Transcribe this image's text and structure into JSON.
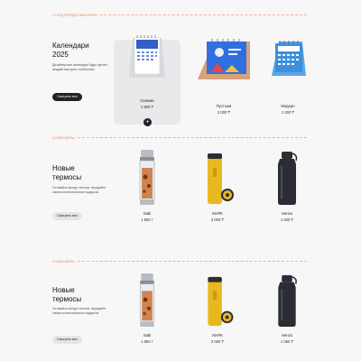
{
  "sections": [
    {
      "label": "СПЕЦПРЕДЛОЖЕНИЯ",
      "title_line1": "Календари",
      "title_line2": "2025",
      "description": "Дизайнерские календари будут делать каждый ваш день особенным",
      "button": "Смотреть все",
      "products": [
        {
          "name": "Синема",
          "price": "1 800 ₸"
        },
        {
          "name": "Пустыня",
          "price": "3 000 ₸"
        },
        {
          "name": "Модерн",
          "price": "1 000 ₸"
        }
      ],
      "add_symbol": "+"
    },
    {
      "label": "СУВЕНИРЫ",
      "title_line1": "Новые",
      "title_line2": "термосы",
      "description": "Оставайся всегда теплым, передайте своим коллегиальным подарком",
      "button": "Смотреть все",
      "products": [
        {
          "name": "Sabi",
          "price": "1 800 т"
        },
        {
          "name": "МАРК",
          "price": "3 000 ₸"
        },
        {
          "name": "Henzo",
          "price": "1 000 ₸"
        }
      ]
    },
    {
      "label": "СУВЕНИРЫ",
      "title_line1": "Новые",
      "title_line2": "термосы",
      "description": "Оставайся всегда теплым, передайте своим коллегиальным подарком",
      "button": "Смотреть все",
      "products": [
        {
          "name": "Sabi",
          "price": "1 800 т"
        },
        {
          "name": "МАРК",
          "price": "3 000 ₸"
        },
        {
          "name": "Henzo",
          "price": "1 050 ₸"
        }
      ]
    }
  ],
  "colors": {
    "accent": "#f07a4a",
    "dark_button": "#1f2328",
    "calendar_blue": "#2f6fe0",
    "thermos_yellow": "#e8b81f",
    "thermos_black": "#2a2d33"
  }
}
